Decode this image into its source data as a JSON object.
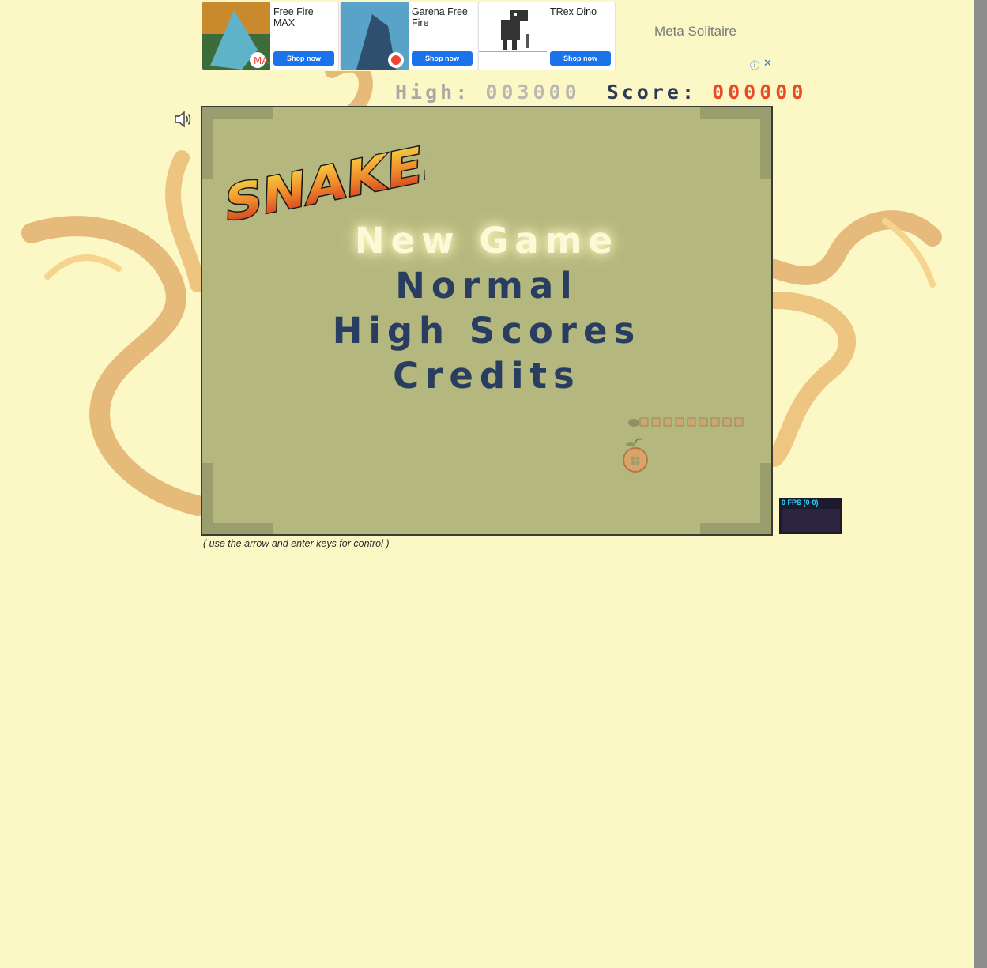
{
  "ads": {
    "cards": [
      {
        "title": "Free Fire MAX",
        "button": "Shop now",
        "thumb_label": "MAX"
      },
      {
        "title": "Garena Free Fire",
        "button": "Shop now"
      },
      {
        "title": "TRex Dino",
        "button": "Shop now"
      }
    ],
    "text_ad": "Meta Solitaire",
    "info_glyph": "ⓘ",
    "close_glyph": "✕"
  },
  "scores": {
    "high_label": "High:",
    "high_value": "003000",
    "score_label": "Score:",
    "score_value": "000000"
  },
  "game": {
    "logo_text": "SNAKES",
    "menu": [
      {
        "label": "New Game",
        "active": true
      },
      {
        "label": "Normal",
        "active": false
      },
      {
        "label": "High Scores",
        "active": false
      },
      {
        "label": "Credits",
        "active": false
      }
    ]
  },
  "hint": "( use the arrow and enter keys for control )",
  "fps": {
    "label": "0 FPS (0-0)"
  },
  "colors": {
    "page_bg": "#fcf8c6",
    "board_bg": "#b4b77e",
    "menu_text": "#283d5f",
    "menu_active": "#fcf9d8",
    "score_value": "#e84a2b",
    "ad_button": "#1a73e8"
  },
  "icons": {
    "sound": "speaker-icon",
    "apple": "apple-icon",
    "info": "info-icon",
    "close": "close-icon"
  }
}
